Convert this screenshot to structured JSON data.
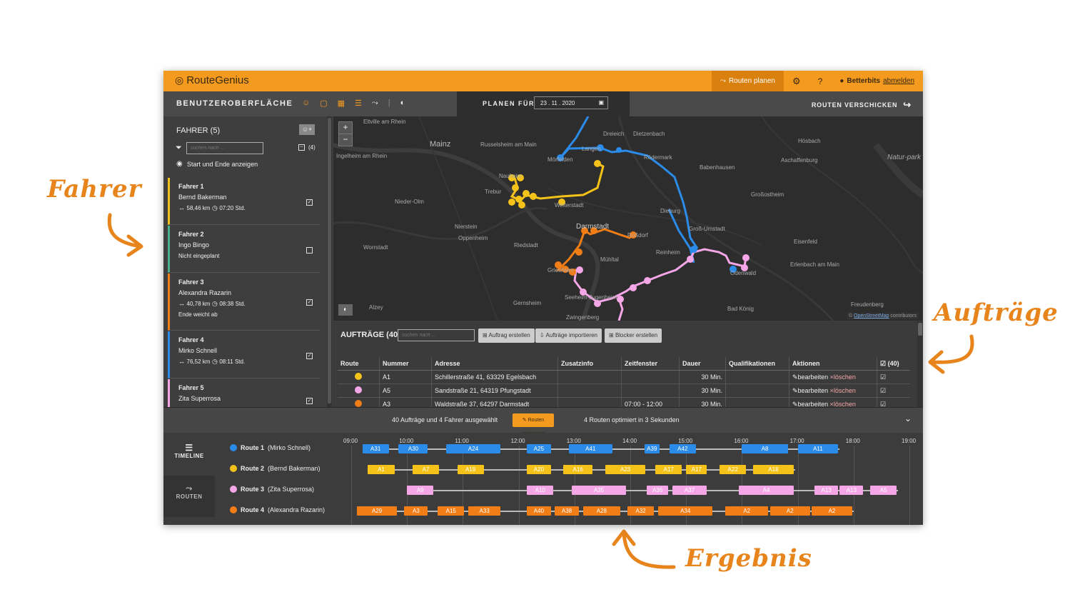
{
  "callouts": {
    "fahrer": "Fahrer",
    "auftraege": "Aufträge",
    "ergebnis": "Ergebnis"
  },
  "colors": {
    "accent": "#f39a1f",
    "route1": "#2b8be8",
    "route2": "#f5c21a",
    "route3": "#f4a6e6",
    "route4": "#f07d16",
    "driver2": "#4caf8a"
  },
  "topbar": {
    "app_name": "RouteGenius",
    "plan_label": "Routen planen",
    "user": "Betterbits",
    "logout": "abmelden"
  },
  "subbar": {
    "title": "BENUTZEROBERFLÄCHE",
    "plan_for": "PLANEN FÜR",
    "date": "23 . 11 . 2020",
    "send": "ROUTEN VERSCHICKEN"
  },
  "sidebar": {
    "title": "FAHRER (5)",
    "search_placeholder": "suchen nach ...",
    "count": "(4)",
    "show_start_end": "Start und Ende anzeigen",
    "drivers": [
      {
        "label": "Fahrer 1",
        "name": "Bernd Bakerman",
        "stats": "58,46 km",
        "time": "07:20 Std.",
        "note": "",
        "checked": true
      },
      {
        "label": "Fahrer 2",
        "name": "Ingo Bingo",
        "stats": "",
        "time": "",
        "note": "Nicht eingeplant",
        "checked": false
      },
      {
        "label": "Fahrer 3",
        "name": "Alexandra Razarin",
        "stats": "40,78 km",
        "time": "08:38 Std.",
        "note": "Ende weicht ab",
        "checked": true
      },
      {
        "label": "Fahrer 4",
        "name": "Mirko Schnell",
        "stats": "76,52 km",
        "time": "08:11 Std.",
        "note": "",
        "checked": true
      },
      {
        "label": "Fahrer 5",
        "name": "Zita Superrosa",
        "stats": "",
        "time": "",
        "note": "",
        "checked": true
      }
    ]
  },
  "map": {
    "attribution_prefix": "© ",
    "attribution_link": "OpenStreetMap",
    "attribution_suffix": " contributors",
    "places": [
      "Mainz",
      "Eltville am Rhein",
      "Ingelheim am Rhein",
      "Russelsheim am Main",
      "Dreieich",
      "Dietzenbach",
      "Langen",
      "Mörfelden",
      "Rödermark",
      "Babenhausen",
      "Aschaffenburg",
      "Hösbach",
      "Trebur",
      "Nauheim",
      "Weiterstadt",
      "Groß-Umstadt",
      "Dieburg",
      "Großostheim",
      "Nieder-Olm",
      "Nierstein",
      "Oppenheim",
      "Riedstadt",
      "Darmstadt",
      "Roßdorf",
      "Worrstadt",
      "Mühltal",
      "Reinheim",
      "Odenwald",
      "Griesheim",
      "Seeheim-Jugenheim",
      "Gernsheim",
      "Zwingenberg",
      "Alzey",
      "Bad König",
      "Erlenbach am Main",
      "Freudenberg",
      "Eisenfeld",
      "Natur-park Spessart"
    ]
  },
  "orders": {
    "title": "AUFTRÄGE (40)",
    "search_placeholder": "suchen nach ...",
    "buttons": [
      "Auftrag erstellen",
      "Aufträge importieren",
      "Blocker erstellen"
    ],
    "columns": [
      "Route",
      "Nummer",
      "Adresse",
      "Zusatzinfo",
      "Zeitfenster",
      "Dauer",
      "Qualifikationen",
      "Aktionen",
      "(40)"
    ],
    "edit": "bearbeiten",
    "delete": "löschen",
    "rows": [
      {
        "color": "#f5c21a",
        "nummer": "A1",
        "adresse": "Schillerstraße 41, 63329 Egelsbach",
        "zusatz": "",
        "zeit": "",
        "dauer": "30 Min."
      },
      {
        "color": "#f4a6e6",
        "nummer": "A5",
        "adresse": "Sandstraße 21, 64319 Pfungstadt",
        "zusatz": "",
        "zeit": "",
        "dauer": "30 Min."
      },
      {
        "color": "#f07d16",
        "nummer": "A3",
        "adresse": "Waldstraße 37, 64297 Darmstadt",
        "zusatz": "",
        "zeit": "07:00 - 12:00",
        "dauer": "30 Min."
      }
    ]
  },
  "optbar": {
    "selected": "40 Aufträge und 4 Fahrer ausgewählt",
    "button": "Routen optimieren",
    "result": "4 Routen optimiert in 3 Sekunden"
  },
  "timeline": {
    "tab_timeline": "TIMELINE",
    "tab_routes": "ROUTEN",
    "hours": [
      "09:00",
      "10:00",
      "11:00",
      "12:00",
      "13:00",
      "14:00",
      "15:00",
      "16:00",
      "17:00",
      "18:00",
      "19:00"
    ],
    "routes": [
      {
        "name": "Route 1",
        "driver": "(Mirko Schnell)",
        "color": "#2b8be8",
        "segments": [
          [
            "A31",
            9.2,
            9.7
          ],
          [
            "A30",
            9.85,
            10.4
          ],
          [
            "A24",
            10.7,
            11.7
          ],
          [
            "A25",
            12.15,
            12.6
          ],
          [
            "A41",
            12.9,
            13.7
          ],
          [
            "A39",
            14.25,
            14.55
          ],
          [
            "A42",
            14.7,
            15.2
          ],
          [
            "A8",
            16.0,
            16.85
          ],
          [
            "A11",
            17.0,
            17.75
          ]
        ]
      },
      {
        "name": "Route 2",
        "driver": "(Bernd Bakerman)",
        "color": "#f5c21a",
        "segments": [
          [
            "A1",
            9.3,
            9.8
          ],
          [
            "A7",
            10.1,
            10.6
          ],
          [
            "A19",
            10.9,
            11.4
          ],
          [
            "A20",
            12.15,
            12.6
          ],
          [
            "A16",
            12.8,
            13.35
          ],
          [
            "A23",
            13.55,
            14.3
          ],
          [
            "A17",
            14.45,
            14.95
          ],
          [
            "A17",
            15.0,
            15.4
          ],
          [
            "A22",
            15.6,
            16.1
          ],
          [
            "A18",
            16.2,
            16.95
          ]
        ]
      },
      {
        "name": "Route 3",
        "driver": "(Zita Superrosa)",
        "color": "#f4a6e6",
        "segments": [
          [
            "A9",
            10.0,
            10.5
          ],
          [
            "A10",
            12.15,
            12.65
          ],
          [
            "A35",
            12.95,
            13.95
          ],
          [
            "A36",
            14.3,
            14.7
          ],
          [
            "A37",
            14.75,
            15.4
          ],
          [
            "A4",
            15.95,
            16.95
          ],
          [
            "A13",
            17.3,
            17.75
          ],
          [
            "A13",
            17.75,
            18.2
          ],
          [
            "A5",
            18.3,
            18.8
          ]
        ]
      },
      {
        "name": "Route 4",
        "driver": "(Alexandra Razarin)",
        "color": "#f07d16",
        "segments": [
          [
            "A29",
            9.1,
            9.85
          ],
          [
            "A3",
            9.95,
            10.4
          ],
          [
            "A15",
            10.55,
            11.05
          ],
          [
            "A33",
            11.1,
            11.7
          ],
          [
            "A40",
            12.15,
            12.6
          ],
          [
            "A38",
            12.65,
            13.1
          ],
          [
            "A28",
            13.15,
            13.85
          ],
          [
            "A32",
            13.95,
            14.45
          ],
          [
            "A34",
            14.5,
            15.5
          ],
          [
            "A2",
            15.7,
            16.5
          ],
          [
            "A2",
            16.5,
            17.25
          ],
          [
            "A2",
            17.25,
            18.0
          ]
        ]
      }
    ]
  }
}
